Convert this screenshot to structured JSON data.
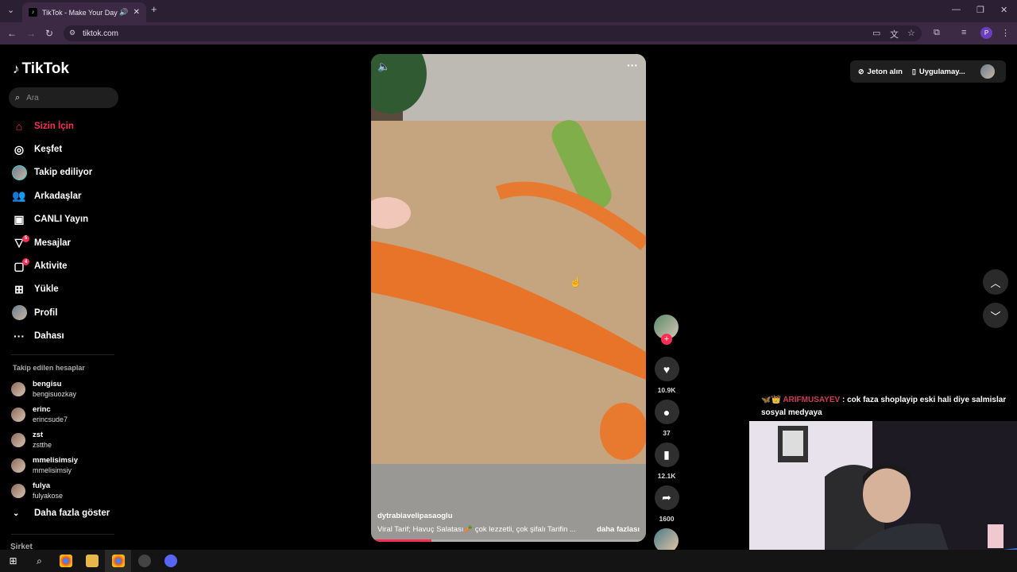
{
  "browser": {
    "tab_title": "TikTok - Make Your Day",
    "url": "tiktok.com",
    "profile_letter": "P"
  },
  "sidebar": {
    "logo": "TikTok",
    "search_placeholder": "Ara",
    "menu": [
      {
        "label": "Sizin İçin",
        "icon": "home-icon"
      },
      {
        "label": "Keşfet",
        "icon": "compass-icon"
      },
      {
        "label": "Takip ediliyor",
        "icon": "following-avatar"
      },
      {
        "label": "Arkadaşlar",
        "icon": "friends-icon"
      },
      {
        "label": "CANLI Yayın",
        "icon": "live-icon"
      },
      {
        "label": "Mesajlar",
        "icon": "message-icon",
        "badge": "5"
      },
      {
        "label": "Aktivite",
        "icon": "activity-icon",
        "badge": "4"
      },
      {
        "label": "Yükle",
        "icon": "upload-icon"
      },
      {
        "label": "Profil",
        "icon": "profile-avatar"
      },
      {
        "label": "Dahası",
        "icon": "more-dots-icon"
      }
    ],
    "following_header": "Takip edilen hesaplar",
    "accounts": [
      {
        "name": "bengisu",
        "handle": "bengisuozkay"
      },
      {
        "name": "erinc",
        "handle": "erincsude7"
      },
      {
        "name": "zst",
        "handle": "zstthe"
      },
      {
        "name": "mmelisimsiy",
        "handle": "mmelisimsiy"
      },
      {
        "name": "fulya",
        "handle": "fulyakose"
      }
    ],
    "show_more": "Daha fazla göster",
    "company": "Şirket"
  },
  "video": {
    "username": "dytrabiavelipasaoglu",
    "description": "Viral Tarif; Havuç Salatası🥕 çok lezzetli, çok şifalı Tarifin ...",
    "more": "daha fazlası",
    "progress": 0.22
  },
  "actions": {
    "likes": "10.9K",
    "comments": "37",
    "saves": "12.1K",
    "shares": "1600"
  },
  "topright": {
    "coins": "Jeton alın",
    "app": "Uygulamay..."
  },
  "chat": {
    "user": "ARIFMUSAYEV",
    "message": ": cok faza shoplayip eski hali diye salmislar sosyal medyaya"
  }
}
